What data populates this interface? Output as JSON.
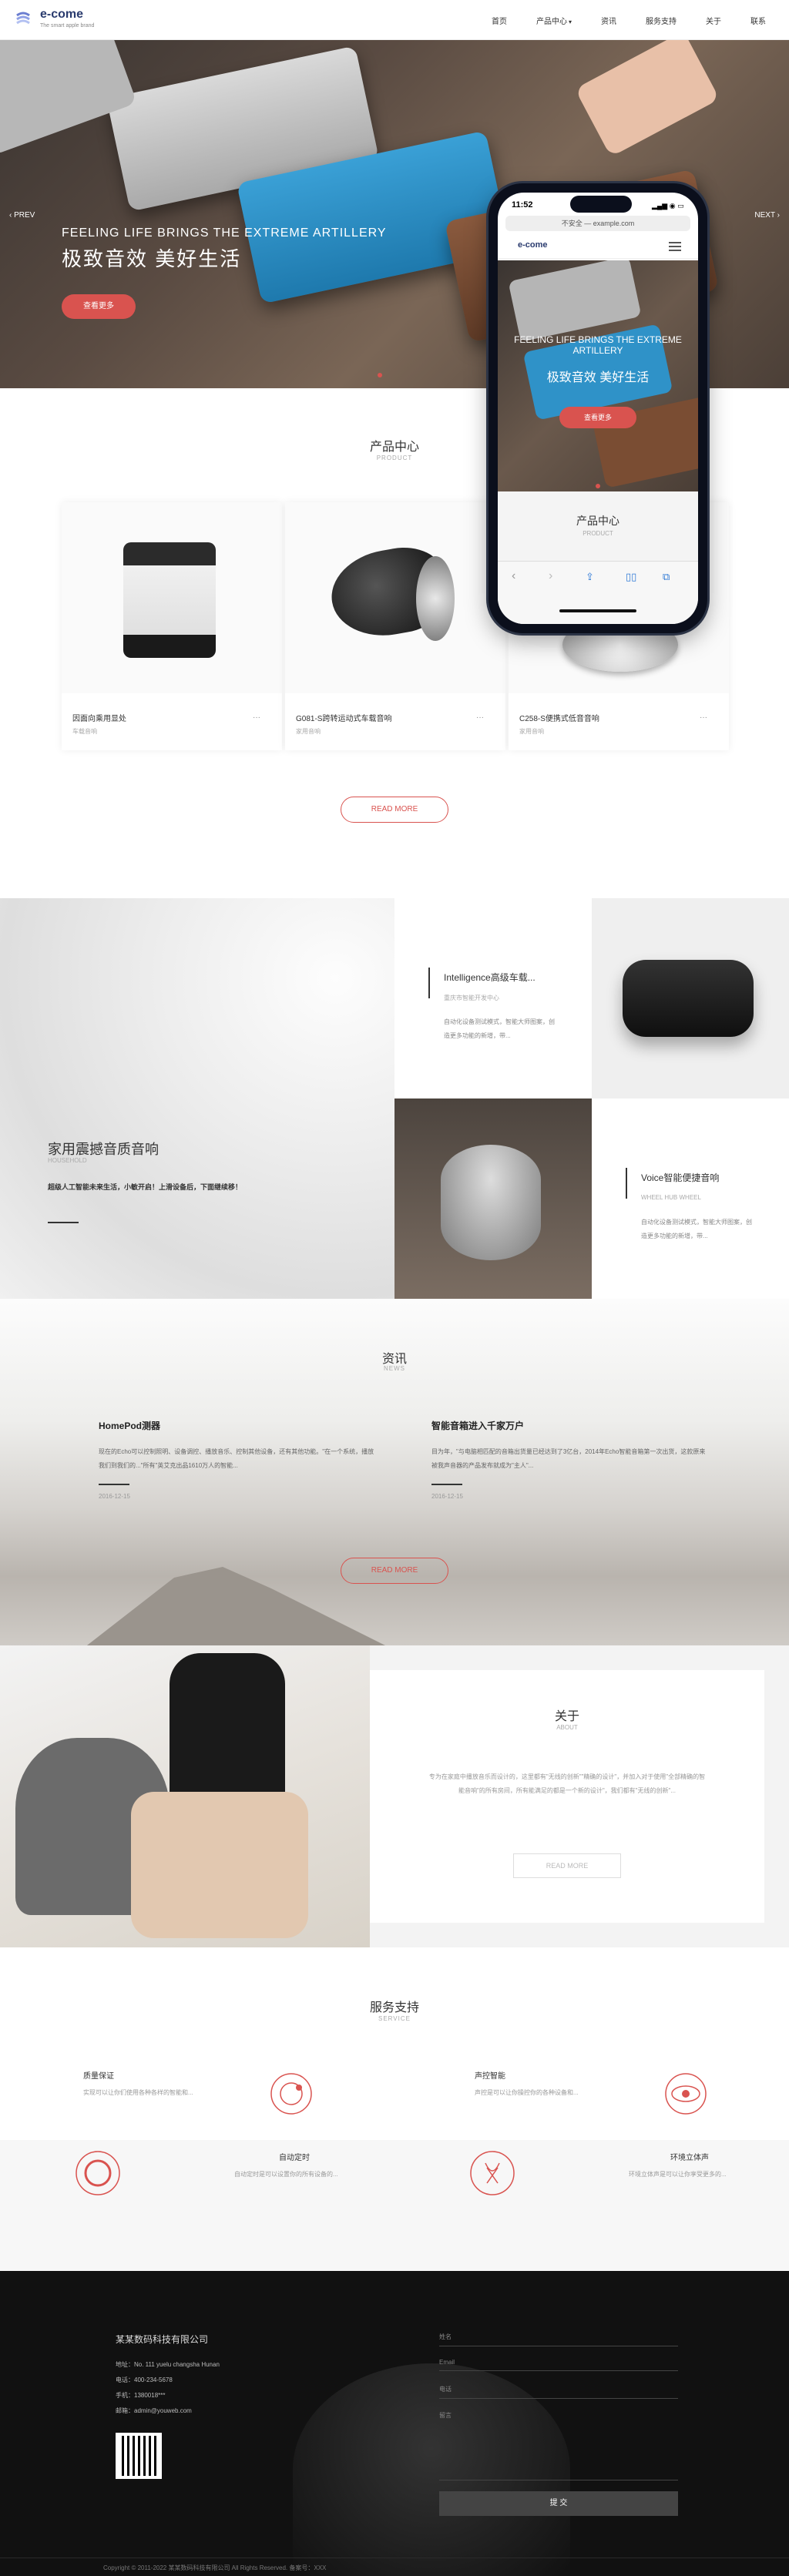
{
  "header": {
    "logo": "e-come",
    "logo_sub": "The smart apple brand",
    "nav": [
      "首页",
      "产品中心",
      "资讯",
      "服务支持",
      "关于",
      "联系"
    ],
    "nav_caret": "▾"
  },
  "hero": {
    "title_en": "FEELING LIFE BRINGS THE EXTREME ARTILLERY",
    "title_cn": "极致音效 美好生活",
    "button": "查看更多",
    "prev": "PREV",
    "next": "NEXT",
    "slide_count": 3,
    "active_slide": 1
  },
  "products": {
    "title": "产品中心",
    "subtitle": "PRODUCT",
    "items": [
      {
        "name": "因面向乘用显处",
        "cat": "车载音响",
        "more": "···"
      },
      {
        "name": "G081-S跨转运动式车载音响",
        "cat": "家用音响",
        "more": "···"
      },
      {
        "name": "C258-S便携式低音音响",
        "cat": "家用音响",
        "more": "···"
      }
    ],
    "read_more": "READ MORE"
  },
  "feature": {
    "title": "家用震撼音质音响",
    "subtitle": "HOUSEHOLD",
    "desc": "超级人工智能未来生活，小敏开启！上滑设备后，下面继续移！",
    "box1": {
      "title": "Intelligence高级车载...",
      "sub": "重庆市智能开发中心",
      "desc": "自动化设备测试模式，智能大师图案，创造更多功能的新增，带..."
    },
    "box2": {
      "title": "Voice智能便捷音响",
      "sub": "WHEEL HUB WHEEL",
      "desc": "自动化设备测试模式，智能大师图案，创造更多功能的新增，带..."
    }
  },
  "news": {
    "title": "资讯",
    "subtitle": "NEWS",
    "items": [
      {
        "title": "HomePod测器",
        "body": "现在的Echo可以控制照明、设备调控、播放音乐、控制其他设备，还有其他功能。\"在一个系统，播放我们到我们的...\"所有\"英艾克出品1610万人的智能...",
        "date": "2016-12-15"
      },
      {
        "title": "智能音箱进入千家万户",
        "body": "目为年，\"与电脑相匹配的音箱出货量已经达到了3亿台，2014年Echo智能音箱第一次出货，这款原来被我声音器的产品发布就成为\"主人\"...",
        "date": "2016-12-15"
      }
    ],
    "read_more": "READ MORE"
  },
  "about": {
    "title": "关于",
    "subtitle": "ABOUT",
    "body": "专为在家庭中播放音乐而设计的，这里都有\"无线的创新\"\"精确的设计\"，并加入对于使用\"全部精确的智能音响\"的所有房间，所有能满足的都是一个新的设计\"，我们都有\"无线的创新\"...",
    "button": "READ MORE"
  },
  "service": {
    "title": "服务支持",
    "subtitle": "SERVICE",
    "items": [
      {
        "title": "质量保证",
        "body": "实现可以让你们使用各种各样的智能和..."
      },
      {
        "title": "声控智能",
        "body": "声控是可以让你操控你的各种设备和..."
      },
      {
        "title": "自动定时",
        "body": "自动定时是可以设置你的所有设备的..."
      },
      {
        "title": "环境立体声",
        "body": "环境立体声是可以让你享受更多的..."
      }
    ]
  },
  "footer": {
    "company": "某某数码科技有限公司",
    "address": "地址：No. 111 yuelu changsha Hunan",
    "phone": "电话：400-234-5678",
    "mobile": "手机：1380018***",
    "email": "邮箱：admin@youweb.com",
    "form": {
      "name": "姓名",
      "email": "Email",
      "phone": "电话",
      "message": "留言",
      "submit": "提 交"
    },
    "copyright": "Copyright © 2011-2022 某某数码科技有限公司 All Rights Reserved. 备案号：XXX"
  },
  "phone": {
    "time": "11:52",
    "url": "不安全 — example.com",
    "page_title": "产品中心",
    "page_sub": "PRODUCT",
    "hero_en": "FEELING LIFE BRINGS THE EXTREME ARTILLERY",
    "hero_cn": "极致音效 美好生活",
    "hero_btn": "查看更多",
    "logo": "e-come"
  }
}
